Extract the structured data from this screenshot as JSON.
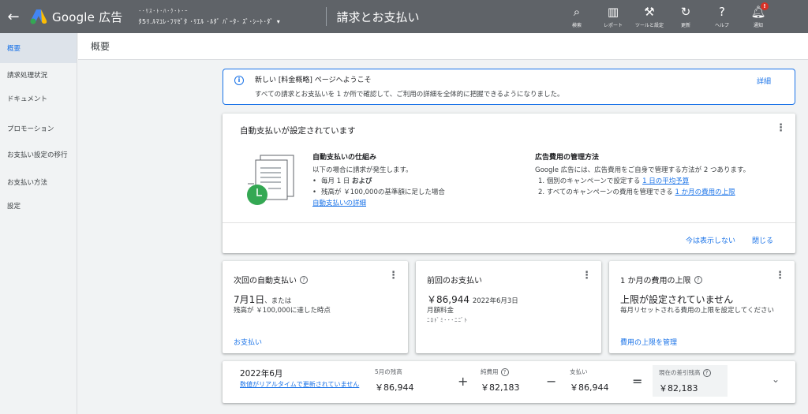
{
  "header": {
    "logo_text": "Google 広告",
    "account_line1": "･･ﾘｽ･ﾄ･ﾊ･ｸ･ﾄ･ｰ",
    "account_line2": "ﾀ5ﾘ.ﾙﾏﾕﾚ･ﾌﾘｾﾞﾀ ･ﾘｴﾙ ･ﾙﾀﾞ ﾊﾞｰﾀ･ ｽﾞ･ｼｰﾄ･ﾀﾞ",
    "page_title": "請求とお支払い",
    "tools": [
      {
        "icon": "search-icon",
        "glyph": "⌕",
        "label": "検索"
      },
      {
        "icon": "report-icon",
        "glyph": "▥",
        "label": "レポート"
      },
      {
        "icon": "wrench-icon",
        "glyph": "⚒",
        "label": "ツールと設定"
      },
      {
        "icon": "refresh-icon",
        "glyph": "↻",
        "label": "更新"
      },
      {
        "icon": "help-icon",
        "glyph": "?",
        "label": "ヘルプ"
      },
      {
        "icon": "bell-icon",
        "glyph": "🔔︎",
        "label": "通知",
        "badge": "!"
      }
    ]
  },
  "sidebar": {
    "items": [
      {
        "label": "概要",
        "active": true
      },
      {
        "label": "請求処理状況"
      },
      {
        "label": "ドキュメント"
      },
      {
        "label": "プロモーション"
      },
      {
        "label": "お支払い設定の移行"
      },
      {
        "label": "お支払い方法"
      },
      {
        "label": "設定"
      }
    ]
  },
  "subheader": {
    "title": "概要"
  },
  "banner": {
    "title": "新しい [料金概略] ページへようこそ",
    "text": "すべての請求とお支払いを 1 か所で確認して、ご利用の詳細を全体的に把握できるようになりました。",
    "link": "詳細"
  },
  "autopay": {
    "title": "自動支払いが設定されています",
    "how_title": "自動支払いの仕組み",
    "how_text": "以下の場合に請求が発生します。",
    "bullet1": "毎月 1 日",
    "bullet1_bold": "および",
    "bullet2": "残高が ￥100,000の基準額に足した場合",
    "how_link": "自動支払いの詳細",
    "manage_title": "広告費用の管理方法",
    "manage_text": "Google 広告には、広告費用をご自身で管理する方法が 2 つあります。",
    "manage1_text": "1. 個別のキャンペーンで設定する ",
    "manage1_link": "1 日の平均予算",
    "manage2_text": "2. すべてのキャンペーンの費用を管理できる ",
    "manage2_link": "1 か月の費用の上限",
    "hide": "今は表示しない",
    "close": "閉じる"
  },
  "cards": {
    "next": {
      "title": "次回の自動支払い",
      "date": "7月1日",
      "date_suffix": "、または",
      "sub": "残高が ￥100,000に達した時点",
      "link": "お支払い"
    },
    "last": {
      "title": "前回のお支払い",
      "amount": "￥86,944",
      "date": "2022年6月3日",
      "sub": "月額料金",
      "masked": "ﾆﾛﾄﾞﾐ･･･ﾆﾆﾞﾄ"
    },
    "limit": {
      "title": "1 か月の費用の上限",
      "status": "上限が設定されていません",
      "sub": "毎月リセットされる費用の上限を設定してください",
      "link": "費用の上限を管理"
    }
  },
  "summary": {
    "month": "2022年6月",
    "note": "数値がリアルタイムで更新されていません",
    "balance_label": "5月の残高",
    "balance": "￥86,944",
    "plus": "+",
    "cost_label": "純費用",
    "cost": "￥82,183",
    "minus": "−",
    "paid_label": "支払い",
    "paid": "￥86,944",
    "equals": "=",
    "current_label": "現在の差引残高",
    "current": "￥82,183"
  },
  "colors": {
    "topbar": "#5f6368",
    "accent": "#1a73e8",
    "clock": "#34a853"
  }
}
